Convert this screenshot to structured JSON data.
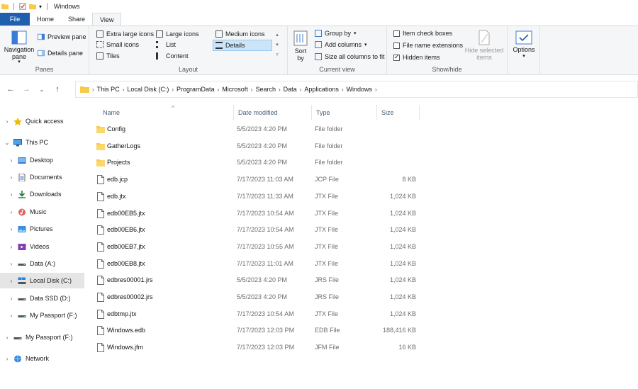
{
  "window": {
    "title": "Windows"
  },
  "ribbon": {
    "tabs": [
      "File",
      "Home",
      "Share",
      "View"
    ],
    "panes": {
      "navigation_pane": "Navigation pane",
      "preview_pane": "Preview pane",
      "details_pane": "Details pane",
      "label": "Panes"
    },
    "layout": {
      "items": [
        "Extra large icons",
        "Large icons",
        "Medium icons",
        "Small icons",
        "List",
        "Details",
        "Tiles",
        "Content"
      ],
      "selected": "Details",
      "label": "Layout"
    },
    "current_view": {
      "sort_by": "Sort by",
      "group_by": "Group by",
      "add_columns": "Add columns",
      "size_all": "Size all columns to fit",
      "label": "Current view"
    },
    "show_hide": {
      "item_check_boxes": "Item check boxes",
      "file_name_extensions": "File name extensions",
      "hidden_items": "Hidden items",
      "hide_selected": "Hide selected items",
      "label": "Show/hide",
      "item_check_boxes_checked": false,
      "file_name_extensions_checked": false,
      "hidden_items_checked": true
    },
    "options": "Options"
  },
  "address": {
    "crumbs": [
      "This PC",
      "Local Disk (C:)",
      "ProgramData",
      "Microsoft",
      "Search",
      "Data",
      "Applications",
      "Windows"
    ]
  },
  "nav": {
    "items": [
      {
        "label": "Quick access",
        "icon": "star-icon",
        "level": 0,
        "expand": "›"
      },
      {
        "label": "This PC",
        "icon": "pc-icon",
        "level": 0,
        "expand": "⌄"
      },
      {
        "label": "Desktop",
        "icon": "desktop-folder-icon",
        "level": 1,
        "expand": "›"
      },
      {
        "label": "Documents",
        "icon": "documents-icon",
        "level": 1,
        "expand": "›"
      },
      {
        "label": "Downloads",
        "icon": "download-icon",
        "level": 1,
        "expand": "›"
      },
      {
        "label": "Music",
        "icon": "music-icon",
        "level": 1,
        "expand": "›"
      },
      {
        "label": "Pictures",
        "icon": "pictures-icon",
        "level": 1,
        "expand": "›"
      },
      {
        "label": "Videos",
        "icon": "videos-icon",
        "level": 1,
        "expand": "›"
      },
      {
        "label": "Data (A:)",
        "icon": "drive-icon",
        "level": 1,
        "expand": "›"
      },
      {
        "label": "Local Disk (C:)",
        "icon": "windows-drive-icon",
        "level": 1,
        "expand": "›",
        "selected": true
      },
      {
        "label": "Data SSD (D:)",
        "icon": "drive-icon",
        "level": 1,
        "expand": "›"
      },
      {
        "label": "My Passport (F:)",
        "icon": "drive-icon",
        "level": 1,
        "expand": "›"
      },
      {
        "label": "My Passport (F:)",
        "icon": "drive-icon",
        "level": 0,
        "expand": "›"
      },
      {
        "label": "Network",
        "icon": "network-icon",
        "level": 0,
        "expand": "›"
      }
    ]
  },
  "columns": {
    "name": "Name",
    "date": "Date modified",
    "type": "Type",
    "size": "Size"
  },
  "files": [
    {
      "name": "Config",
      "date": "5/5/2023 4:20 PM",
      "type": "File folder",
      "size": "",
      "kind": "folder"
    },
    {
      "name": "GatherLogs",
      "date": "5/5/2023 4:20 PM",
      "type": "File folder",
      "size": "",
      "kind": "folder"
    },
    {
      "name": "Projects",
      "date": "5/5/2023 4:20 PM",
      "type": "File folder",
      "size": "",
      "kind": "folder"
    },
    {
      "name": "edb.jcp",
      "date": "7/17/2023 11:03 AM",
      "type": "JCP File",
      "size": "8 KB",
      "kind": "file"
    },
    {
      "name": "edb.jtx",
      "date": "7/17/2023 11:33 AM",
      "type": "JTX File",
      "size": "1,024 KB",
      "kind": "file"
    },
    {
      "name": "edb00EB5.jtx",
      "date": "7/17/2023 10:54 AM",
      "type": "JTX File",
      "size": "1,024 KB",
      "kind": "file"
    },
    {
      "name": "edb00EB6.jtx",
      "date": "7/17/2023 10:54 AM",
      "type": "JTX File",
      "size": "1,024 KB",
      "kind": "file"
    },
    {
      "name": "edb00EB7.jtx",
      "date": "7/17/2023 10:55 AM",
      "type": "JTX File",
      "size": "1,024 KB",
      "kind": "file"
    },
    {
      "name": "edb00EB8.jtx",
      "date": "7/17/2023 11:01 AM",
      "type": "JTX File",
      "size": "1,024 KB",
      "kind": "file"
    },
    {
      "name": "edbres00001.jrs",
      "date": "5/5/2023 4:20 PM",
      "type": "JRS File",
      "size": "1,024 KB",
      "kind": "file"
    },
    {
      "name": "edbres00002.jrs",
      "date": "5/5/2023 4:20 PM",
      "type": "JRS File",
      "size": "1,024 KB",
      "kind": "file"
    },
    {
      "name": "edbtmp.jtx",
      "date": "7/17/2023 10:54 AM",
      "type": "JTX File",
      "size": "1,024 KB",
      "kind": "file"
    },
    {
      "name": "Windows.edb",
      "date": "7/17/2023 12:03 PM",
      "type": "EDB File",
      "size": "188,416 KB",
      "kind": "file"
    },
    {
      "name": "Windows.jfm",
      "date": "7/17/2023 12:03 PM",
      "type": "JFM File",
      "size": "16 KB",
      "kind": "file"
    }
  ],
  "colors": {
    "file_tab": "#1f5fae",
    "folder": "#f8c94a",
    "selection": "#cce4f7"
  }
}
